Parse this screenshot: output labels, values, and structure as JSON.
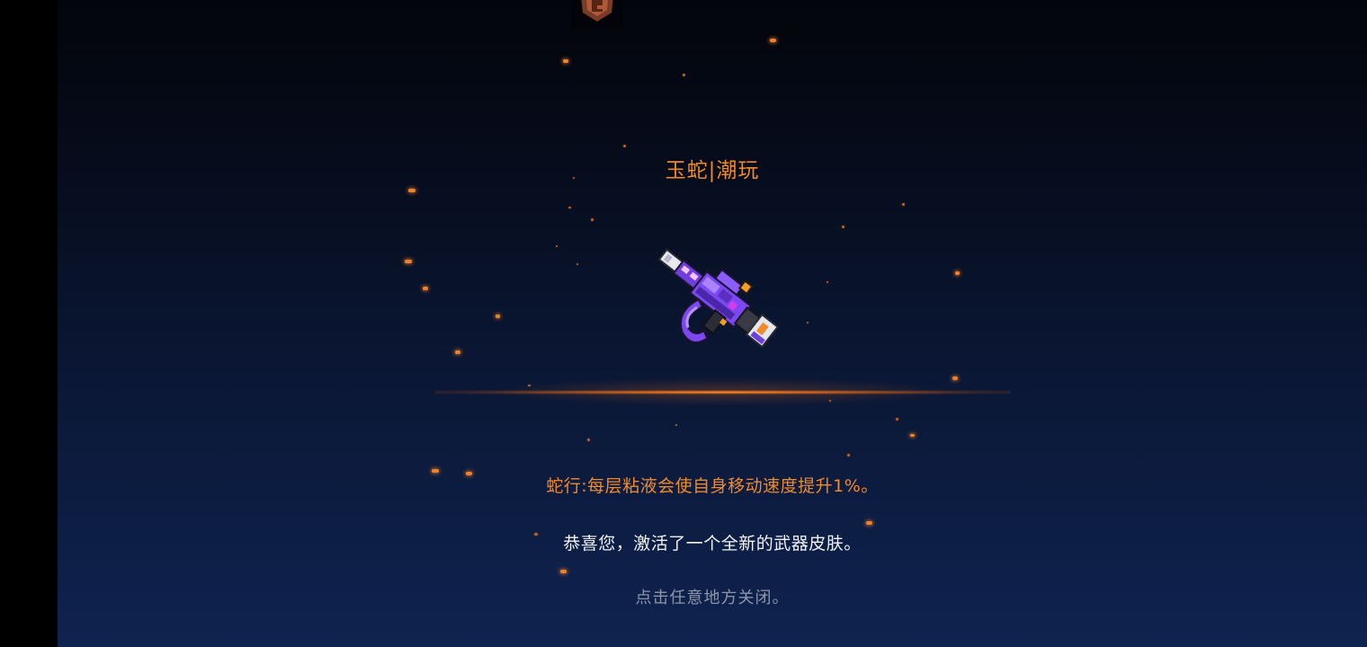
{
  "reward_popup": {
    "skin_name": "玉蛇|潮玩",
    "skill_description": "蛇行:每层粘液会使自身移动速度提升1%。",
    "congrats_message": "恭喜您，激活了一个全新的武器皮肤。",
    "close_hint": "点击任意地方关闭。"
  },
  "colors": {
    "accent_orange": "#f08a2a",
    "text_white": "#f2f2f2",
    "hint_gray": "#8d96a8",
    "background_top": "#03050b",
    "background_bottom": "#0f2350"
  },
  "icons": {
    "top_emblem": "emblem-icon",
    "weapon": "jade-snake-gun-icon"
  }
}
